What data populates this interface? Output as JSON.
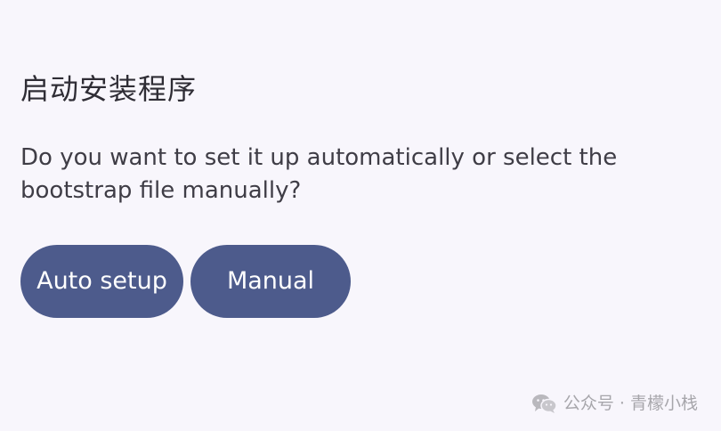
{
  "dialog": {
    "title": "启动安装程序",
    "message": "Do you want to set it up automatically or select the bootstrap file manually?",
    "buttons": {
      "auto_label": "Auto setup",
      "manual_label": "Manual"
    }
  },
  "watermark": {
    "text": "公众号 · 青檬小栈",
    "icon": "wechat-icon"
  },
  "colors": {
    "background": "#f8f6fc",
    "button_fill": "#4d5b8c",
    "button_text": "#ffffff",
    "title_text": "#2f2d35",
    "watermark_text": "#a7a6ab"
  }
}
